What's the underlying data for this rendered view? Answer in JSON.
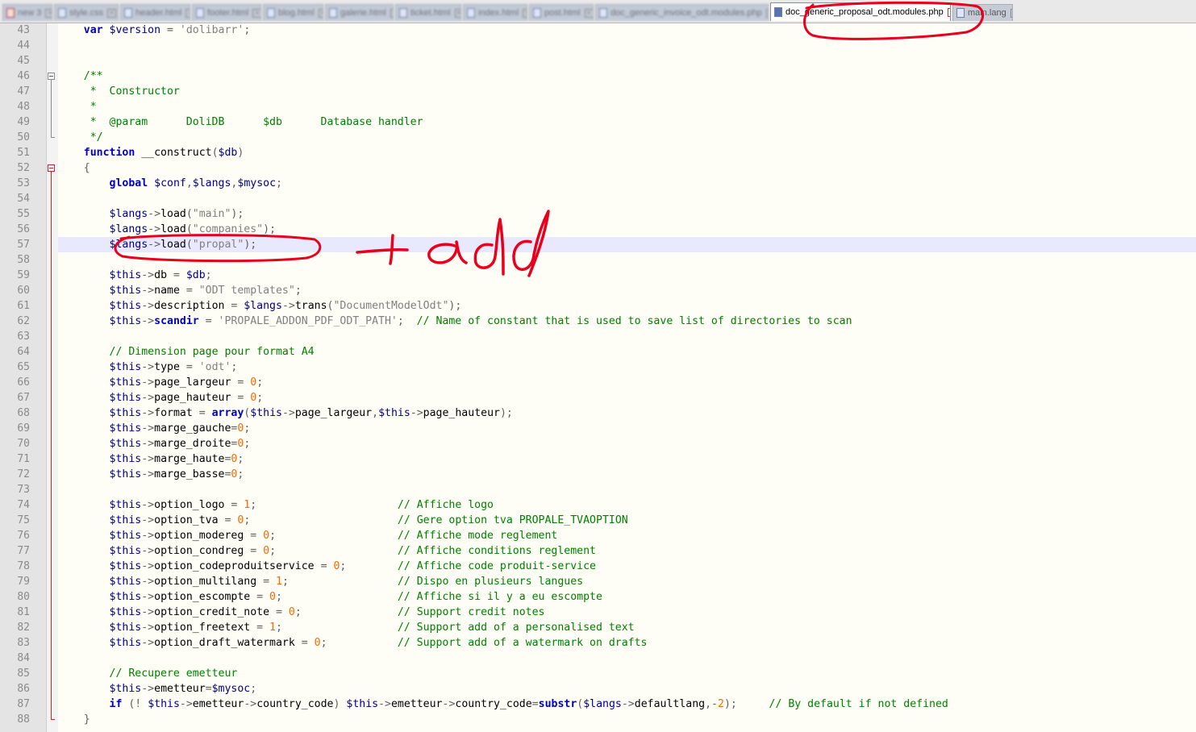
{
  "tabs": [
    {
      "label": "new 3"
    },
    {
      "label": "style.css"
    },
    {
      "label": "header.html"
    },
    {
      "label": "footer.html"
    },
    {
      "label": "blog.html"
    },
    {
      "label": "galerie.html"
    },
    {
      "label": "ticket.html"
    },
    {
      "label": "index.html"
    },
    {
      "label": "post.html"
    },
    {
      "label": "doc_generic_invoice_odt.modules.php"
    },
    {
      "label": "doc_generic_proposal_odt.modules.php",
      "active": true
    },
    {
      "label": "main.lang"
    }
  ],
  "editor": {
    "first_line": 43,
    "current_line": 57,
    "lines": [
      [
        [
          "    ",
          ""
        ],
        [
          "var",
          "kw"
        ],
        [
          " ",
          ""
        ],
        [
          "$version",
          "var"
        ],
        [
          " = ",
          "op"
        ],
        [
          "'dolibarr'",
          "str"
        ],
        [
          ";",
          "op"
        ]
      ],
      [],
      [],
      [
        [
          "    ",
          ""
        ],
        [
          "/**",
          "doc"
        ]
      ],
      [
        [
          "     ",
          ""
        ],
        [
          "*  Constructor",
          "doc"
        ]
      ],
      [
        [
          "     ",
          ""
        ],
        [
          "*",
          "doc"
        ]
      ],
      [
        [
          "     ",
          ""
        ],
        [
          "*  @param      DoliDB      $db      Database handler",
          "doc"
        ]
      ],
      [
        [
          "     ",
          ""
        ],
        [
          "*/",
          "doc"
        ]
      ],
      [
        [
          "    ",
          ""
        ],
        [
          "function",
          "kw"
        ],
        [
          " __construct",
          "fn"
        ],
        [
          "(",
          "op"
        ],
        [
          "$db",
          "var"
        ],
        [
          ")",
          "op"
        ]
      ],
      [
        [
          "    ",
          ""
        ],
        [
          "{",
          "op"
        ]
      ],
      [
        [
          "        ",
          ""
        ],
        [
          "global",
          "kw"
        ],
        [
          " ",
          ""
        ],
        [
          "$conf",
          "var"
        ],
        [
          ",",
          "op"
        ],
        [
          "$langs",
          "var"
        ],
        [
          ",",
          "op"
        ],
        [
          "$mysoc",
          "var"
        ],
        [
          ";",
          "op"
        ]
      ],
      [],
      [
        [
          "        ",
          ""
        ],
        [
          "$langs",
          "var"
        ],
        [
          "->",
          "op"
        ],
        [
          "load",
          "fn"
        ],
        [
          "(",
          "op"
        ],
        [
          "\"main\"",
          "str"
        ],
        [
          ");",
          "op"
        ]
      ],
      [
        [
          "        ",
          ""
        ],
        [
          "$langs",
          "var"
        ],
        [
          "->",
          "op"
        ],
        [
          "load",
          "fn"
        ],
        [
          "(",
          "op"
        ],
        [
          "\"companies\"",
          "str"
        ],
        [
          ");",
          "op"
        ]
      ],
      [
        [
          "        ",
          ""
        ],
        [
          "$langs",
          "var"
        ],
        [
          "->",
          "op"
        ],
        [
          "load",
          "fn"
        ],
        [
          "(",
          "op"
        ],
        [
          "\"propal\"",
          "str"
        ],
        [
          ");",
          "op"
        ]
      ],
      [],
      [
        [
          "        ",
          ""
        ],
        [
          "$this",
          "var"
        ],
        [
          "->",
          "op"
        ],
        [
          "db",
          "fn"
        ],
        [
          " = ",
          "op"
        ],
        [
          "$db",
          "var"
        ],
        [
          ";",
          "op"
        ]
      ],
      [
        [
          "        ",
          ""
        ],
        [
          "$this",
          "var"
        ],
        [
          "->",
          "op"
        ],
        [
          "name",
          "fn"
        ],
        [
          " = ",
          "op"
        ],
        [
          "\"ODT templates\"",
          "str"
        ],
        [
          ";",
          "op"
        ]
      ],
      [
        [
          "        ",
          ""
        ],
        [
          "$this",
          "var"
        ],
        [
          "->",
          "op"
        ],
        [
          "description",
          "fn"
        ],
        [
          " = ",
          "op"
        ],
        [
          "$langs",
          "var"
        ],
        [
          "->",
          "op"
        ],
        [
          "trans",
          "fn"
        ],
        [
          "(",
          "op"
        ],
        [
          "\"DocumentModelOdt\"",
          "str"
        ],
        [
          ");",
          "op"
        ]
      ],
      [
        [
          "        ",
          ""
        ],
        [
          "$this",
          "var"
        ],
        [
          "->",
          "op"
        ],
        [
          "scandir",
          "kw"
        ],
        [
          " = ",
          "op"
        ],
        [
          "'PROPALE_ADDON_PDF_ODT_PATH'",
          "str"
        ],
        [
          ";  ",
          "op"
        ],
        [
          "// Name of constant that is used to save list of directories to scan",
          "cmt"
        ]
      ],
      [],
      [
        [
          "        ",
          ""
        ],
        [
          "// Dimension page pour format A4",
          "cmt"
        ]
      ],
      [
        [
          "        ",
          ""
        ],
        [
          "$this",
          "var"
        ],
        [
          "->",
          "op"
        ],
        [
          "type",
          "fn"
        ],
        [
          " = ",
          "op"
        ],
        [
          "'odt'",
          "str"
        ],
        [
          ";",
          "op"
        ]
      ],
      [
        [
          "        ",
          ""
        ],
        [
          "$this",
          "var"
        ],
        [
          "->",
          "op"
        ],
        [
          "page_largeur",
          "fn"
        ],
        [
          " = ",
          "op"
        ],
        [
          "0",
          "num"
        ],
        [
          ";",
          "op"
        ]
      ],
      [
        [
          "        ",
          ""
        ],
        [
          "$this",
          "var"
        ],
        [
          "->",
          "op"
        ],
        [
          "page_hauteur",
          "fn"
        ],
        [
          " = ",
          "op"
        ],
        [
          "0",
          "num"
        ],
        [
          ";",
          "op"
        ]
      ],
      [
        [
          "        ",
          ""
        ],
        [
          "$this",
          "var"
        ],
        [
          "->",
          "op"
        ],
        [
          "format",
          "fn"
        ],
        [
          " = ",
          "op"
        ],
        [
          "array",
          "kw"
        ],
        [
          "(",
          "op"
        ],
        [
          "$this",
          "var"
        ],
        [
          "->",
          "op"
        ],
        [
          "page_largeur",
          "fn"
        ],
        [
          ",",
          "op"
        ],
        [
          "$this",
          "var"
        ],
        [
          "->",
          "op"
        ],
        [
          "page_hauteur",
          "fn"
        ],
        [
          ");",
          "op"
        ]
      ],
      [
        [
          "        ",
          ""
        ],
        [
          "$this",
          "var"
        ],
        [
          "->",
          "op"
        ],
        [
          "marge_gauche",
          "fn"
        ],
        [
          "=",
          "op"
        ],
        [
          "0",
          "num"
        ],
        [
          ";",
          "op"
        ]
      ],
      [
        [
          "        ",
          ""
        ],
        [
          "$this",
          "var"
        ],
        [
          "->",
          "op"
        ],
        [
          "marge_droite",
          "fn"
        ],
        [
          "=",
          "op"
        ],
        [
          "0",
          "num"
        ],
        [
          ";",
          "op"
        ]
      ],
      [
        [
          "        ",
          ""
        ],
        [
          "$this",
          "var"
        ],
        [
          "->",
          "op"
        ],
        [
          "marge_haute",
          "fn"
        ],
        [
          "=",
          "op"
        ],
        [
          "0",
          "num"
        ],
        [
          ";",
          "op"
        ]
      ],
      [
        [
          "        ",
          ""
        ],
        [
          "$this",
          "var"
        ],
        [
          "->",
          "op"
        ],
        [
          "marge_basse",
          "fn"
        ],
        [
          "=",
          "op"
        ],
        [
          "0",
          "num"
        ],
        [
          ";",
          "op"
        ]
      ],
      [],
      [
        [
          "        ",
          ""
        ],
        [
          "$this",
          "var"
        ],
        [
          "->",
          "op"
        ],
        [
          "option_logo",
          "fn"
        ],
        [
          " = ",
          "op"
        ],
        [
          "1",
          "num"
        ],
        [
          ";                      ",
          "op"
        ],
        [
          "// Affiche logo",
          "cmt"
        ]
      ],
      [
        [
          "        ",
          ""
        ],
        [
          "$this",
          "var"
        ],
        [
          "->",
          "op"
        ],
        [
          "option_tva",
          "fn"
        ],
        [
          " = ",
          "op"
        ],
        [
          "0",
          "num"
        ],
        [
          ";                       ",
          "op"
        ],
        [
          "// Gere option tva PROPALE_TVAOPTION",
          "cmt"
        ]
      ],
      [
        [
          "        ",
          ""
        ],
        [
          "$this",
          "var"
        ],
        [
          "->",
          "op"
        ],
        [
          "option_modereg",
          "fn"
        ],
        [
          " = ",
          "op"
        ],
        [
          "0",
          "num"
        ],
        [
          ";                   ",
          "op"
        ],
        [
          "// Affiche mode reglement",
          "cmt"
        ]
      ],
      [
        [
          "        ",
          ""
        ],
        [
          "$this",
          "var"
        ],
        [
          "->",
          "op"
        ],
        [
          "option_condreg",
          "fn"
        ],
        [
          " = ",
          "op"
        ],
        [
          "0",
          "num"
        ],
        [
          ";                   ",
          "op"
        ],
        [
          "// Affiche conditions reglement",
          "cmt"
        ]
      ],
      [
        [
          "        ",
          ""
        ],
        [
          "$this",
          "var"
        ],
        [
          "->",
          "op"
        ],
        [
          "option_codeproduitservice",
          "fn"
        ],
        [
          " = ",
          "op"
        ],
        [
          "0",
          "num"
        ],
        [
          ";        ",
          "op"
        ],
        [
          "// Affiche code produit-service",
          "cmt"
        ]
      ],
      [
        [
          "        ",
          ""
        ],
        [
          "$this",
          "var"
        ],
        [
          "->",
          "op"
        ],
        [
          "option_multilang",
          "fn"
        ],
        [
          " = ",
          "op"
        ],
        [
          "1",
          "num"
        ],
        [
          ";                 ",
          "op"
        ],
        [
          "// Dispo en plusieurs langues",
          "cmt"
        ]
      ],
      [
        [
          "        ",
          ""
        ],
        [
          "$this",
          "var"
        ],
        [
          "->",
          "op"
        ],
        [
          "option_escompte",
          "fn"
        ],
        [
          " = ",
          "op"
        ],
        [
          "0",
          "num"
        ],
        [
          ";                  ",
          "op"
        ],
        [
          "// Affiche si il y a eu escompte",
          "cmt"
        ]
      ],
      [
        [
          "        ",
          ""
        ],
        [
          "$this",
          "var"
        ],
        [
          "->",
          "op"
        ],
        [
          "option_credit_note",
          "fn"
        ],
        [
          " = ",
          "op"
        ],
        [
          "0",
          "num"
        ],
        [
          ";               ",
          "op"
        ],
        [
          "// Support credit notes",
          "cmt"
        ]
      ],
      [
        [
          "        ",
          ""
        ],
        [
          "$this",
          "var"
        ],
        [
          "->",
          "op"
        ],
        [
          "option_freetext",
          "fn"
        ],
        [
          " = ",
          "op"
        ],
        [
          "1",
          "num"
        ],
        [
          ";                  ",
          "op"
        ],
        [
          "// Support add of a personalised text",
          "cmt"
        ]
      ],
      [
        [
          "        ",
          ""
        ],
        [
          "$this",
          "var"
        ],
        [
          "->",
          "op"
        ],
        [
          "option_draft_watermark",
          "fn"
        ],
        [
          " = ",
          "op"
        ],
        [
          "0",
          "num"
        ],
        [
          ";           ",
          "op"
        ],
        [
          "// Support add of a watermark on drafts",
          "cmt"
        ]
      ],
      [],
      [
        [
          "        ",
          ""
        ],
        [
          "// Recupere emetteur",
          "cmt"
        ]
      ],
      [
        [
          "        ",
          ""
        ],
        [
          "$this",
          "var"
        ],
        [
          "->",
          "op"
        ],
        [
          "emetteur",
          "fn"
        ],
        [
          "=",
          "op"
        ],
        [
          "$mysoc",
          "var"
        ],
        [
          ";",
          "op"
        ]
      ],
      [
        [
          "        ",
          ""
        ],
        [
          "if",
          "kw"
        ],
        [
          " (! ",
          "op"
        ],
        [
          "$this",
          "var"
        ],
        [
          "->",
          "op"
        ],
        [
          "emetteur",
          "fn"
        ],
        [
          "->",
          "op"
        ],
        [
          "country_code",
          "fn"
        ],
        [
          ") ",
          "op"
        ],
        [
          "$this",
          "var"
        ],
        [
          "->",
          "op"
        ],
        [
          "emetteur",
          "fn"
        ],
        [
          "->",
          "op"
        ],
        [
          "country_code",
          "fn"
        ],
        [
          "=",
          "op"
        ],
        [
          "substr",
          "kw"
        ],
        [
          "(",
          "op"
        ],
        [
          "$langs",
          "var"
        ],
        [
          "->",
          "op"
        ],
        [
          "defaultlang",
          "fn"
        ],
        [
          ",-",
          "op"
        ],
        [
          "2",
          "num"
        ],
        [
          ");",
          "op"
        ],
        [
          "     ",
          ""
        ],
        [
          "// By default if not defined",
          "cmt"
        ]
      ],
      [
        [
          "    ",
          ""
        ],
        [
          "}",
          "op"
        ]
      ]
    ]
  },
  "annotation": {
    "handwritten_note": "+ add",
    "ink_color": "#e8001c"
  }
}
